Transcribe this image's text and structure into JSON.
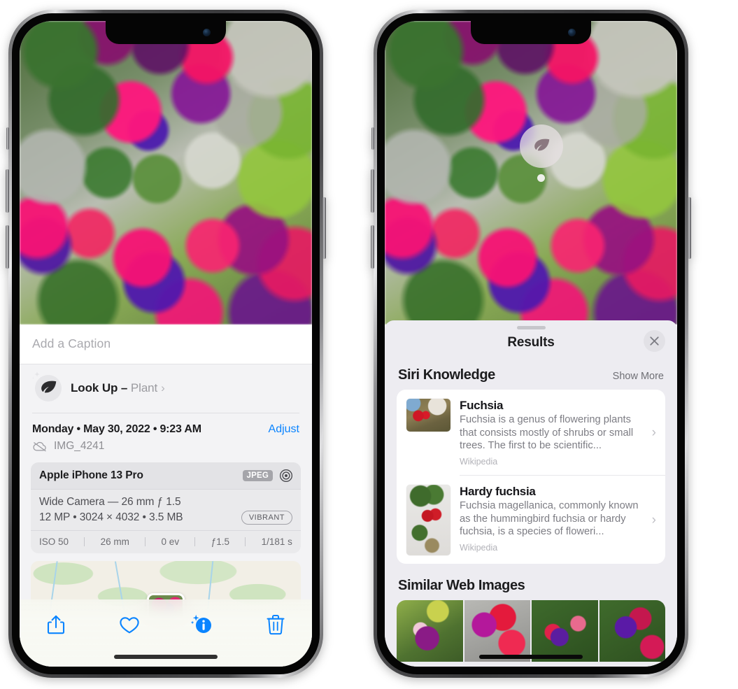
{
  "left_phone": {
    "photo": {
      "alt_name": "fuchsia-flowers-photo"
    },
    "caption": {
      "placeholder": "Add a Caption",
      "value": ""
    },
    "lookup": {
      "label": "Look Up",
      "dash": "–",
      "subject": "Plant",
      "chevron": "›",
      "icon": "leaf-icon"
    },
    "info": {
      "date": "Monday • May 30, 2022 • 9:23 AM",
      "adjust_label": "Adjust",
      "filename": "IMG_4241",
      "cloud_icon": "cloud-slash-icon"
    },
    "metadata": {
      "device": "Apple iPhone 13 Pro",
      "format_badge": "JPEG",
      "aperture_icon": "camera-aperture-icon",
      "lens_line": "Wide Camera — 26 mm ƒ 1.5",
      "size_line": "12 MP • 3024 × 4032 • 3.5 MB",
      "style_badge": "VIBRANT",
      "exif": [
        "ISO 50",
        "26 mm",
        "0 ev",
        "ƒ1.5",
        "1/181 s"
      ]
    },
    "toolbar": [
      {
        "name": "share-button",
        "icon": "share-icon"
      },
      {
        "name": "favorite-button",
        "icon": "heart-icon"
      },
      {
        "name": "info-button",
        "icon": "info-sparkle-icon"
      },
      {
        "name": "delete-button",
        "icon": "trash-icon"
      }
    ]
  },
  "right_phone": {
    "badge": {
      "icon": "leaf-icon",
      "name": "visual-lookup-badge"
    },
    "sheet": {
      "title": "Results",
      "close_icon": "close-icon",
      "sections": [
        {
          "title": "Siri Knowledge",
          "action_label": "Show More",
          "items": [
            {
              "title": "Fuchsia",
              "description": "Fuchsia is a genus of flowering plants that consists mostly of shrubs or small trees. The first to be scientific...",
              "source": "Wikipedia",
              "chevron": "›"
            },
            {
              "title": "Hardy fuchsia",
              "description": "Fuchsia magellanica, commonly known as the hummingbird fuchsia or hardy fuchsia, is a species of floweri...",
              "source": "Wikipedia",
              "chevron": "›"
            }
          ]
        },
        {
          "title": "Similar Web Images",
          "images": [
            "fuchsia-web-image-1",
            "fuchsia-web-image-2",
            "fuchsia-web-image-3",
            "fuchsia-web-image-4"
          ]
        }
      ]
    }
  },
  "colors": {
    "accent_blue": "#0a84ff",
    "sheet_bg": "#f3f3f5",
    "results_bg": "#edecf1",
    "secondary_text": "#8e8e93"
  }
}
